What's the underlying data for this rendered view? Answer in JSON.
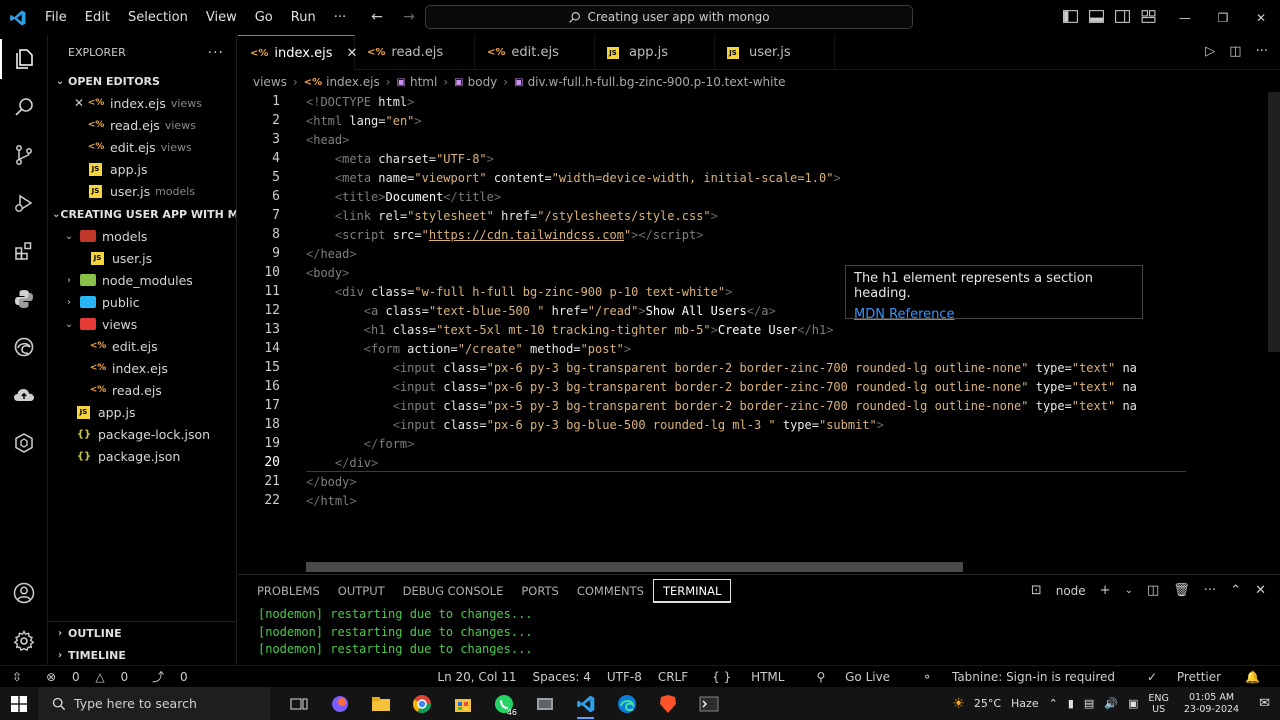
{
  "titlebar": {
    "menu": [
      "File",
      "Edit",
      "Selection",
      "View",
      "Go",
      "Run",
      "···"
    ],
    "search": "Creating user app with mongo"
  },
  "sidebar": {
    "title": "EXPLORER",
    "more": "···",
    "open_editors_label": "OPEN EDITORS",
    "open_editors": [
      {
        "name": "index.ejs",
        "desc": "views",
        "type": "ejs"
      },
      {
        "name": "read.ejs",
        "desc": "views",
        "type": "ejs"
      },
      {
        "name": "edit.ejs",
        "desc": "views",
        "type": "ejs"
      },
      {
        "name": "app.js",
        "desc": "",
        "type": "js"
      },
      {
        "name": "user.js",
        "desc": "models",
        "type": "js"
      }
    ],
    "project_label": "CREATING USER APP WITH M...",
    "tree": {
      "models": "models",
      "user_js": "user.js",
      "node_modules": "node_modules",
      "public": "public",
      "views": "views",
      "edit_ejs": "edit.ejs",
      "index_ejs": "index.ejs",
      "read_ejs": "read.ejs",
      "app_js": "app.js",
      "package_lock": "package-lock.json",
      "package_json": "package.json"
    },
    "outline_label": "OUTLINE",
    "timeline_label": "TIMELINE"
  },
  "tabs": [
    {
      "name": "index.ejs",
      "type": "ejs",
      "active": true
    },
    {
      "name": "read.ejs",
      "type": "ejs"
    },
    {
      "name": "edit.ejs",
      "type": "ejs"
    },
    {
      "name": "app.js",
      "type": "js"
    },
    {
      "name": "user.js",
      "type": "js"
    }
  ],
  "breadcrumb": {
    "views": "views",
    "file": "index.ejs",
    "html": "html",
    "body": "body",
    "div": "div.w-full.h-full.bg-zinc-900.p-10.text-white"
  },
  "editor": {
    "current_line": 20,
    "line_numbers": [
      "1",
      "2",
      "3",
      "4",
      "5",
      "6",
      "7",
      "8",
      "9",
      "10",
      "11",
      "12",
      "13",
      "14",
      "15",
      "16",
      "17",
      "18",
      "19",
      "20",
      "21",
      "22"
    ]
  },
  "hover": {
    "text": "The h1 element represents a section heading.",
    "link": "MDN Reference"
  },
  "panel": {
    "tabs": [
      "PROBLEMS",
      "OUTPUT",
      "DEBUG CONSOLE",
      "PORTS",
      "COMMENTS",
      "TERMINAL"
    ],
    "active": "TERMINAL",
    "shell": "node",
    "lines": [
      "[nodemon] restarting due to changes...",
      "[nodemon] restarting due to changes...",
      "[nodemon] restarting due to changes..."
    ]
  },
  "status": {
    "errors": "0",
    "warnings": "0",
    "ports": "0",
    "position": "Ln 20, Col 11",
    "spaces": "Spaces: 4",
    "encoding": "UTF-8",
    "eol": "CRLF",
    "language": "HTML",
    "golive": "Go Live",
    "tabnine": "Tabnine: Sign-in is required",
    "prettier": "Prettier"
  },
  "taskbar": {
    "search_placeholder": "Type here to search",
    "whatsapp_badge": "46",
    "temperature": "25°C",
    "weather": "Haze",
    "lang_top": "ENG",
    "lang_bottom": "US",
    "time": "01:05 AM",
    "date": "23-09-2024"
  },
  "colors": {
    "accent": "#3794ff",
    "terminal_green": "#4ec94e",
    "ejs": "#f0a84a",
    "js": "#f5d43c"
  }
}
